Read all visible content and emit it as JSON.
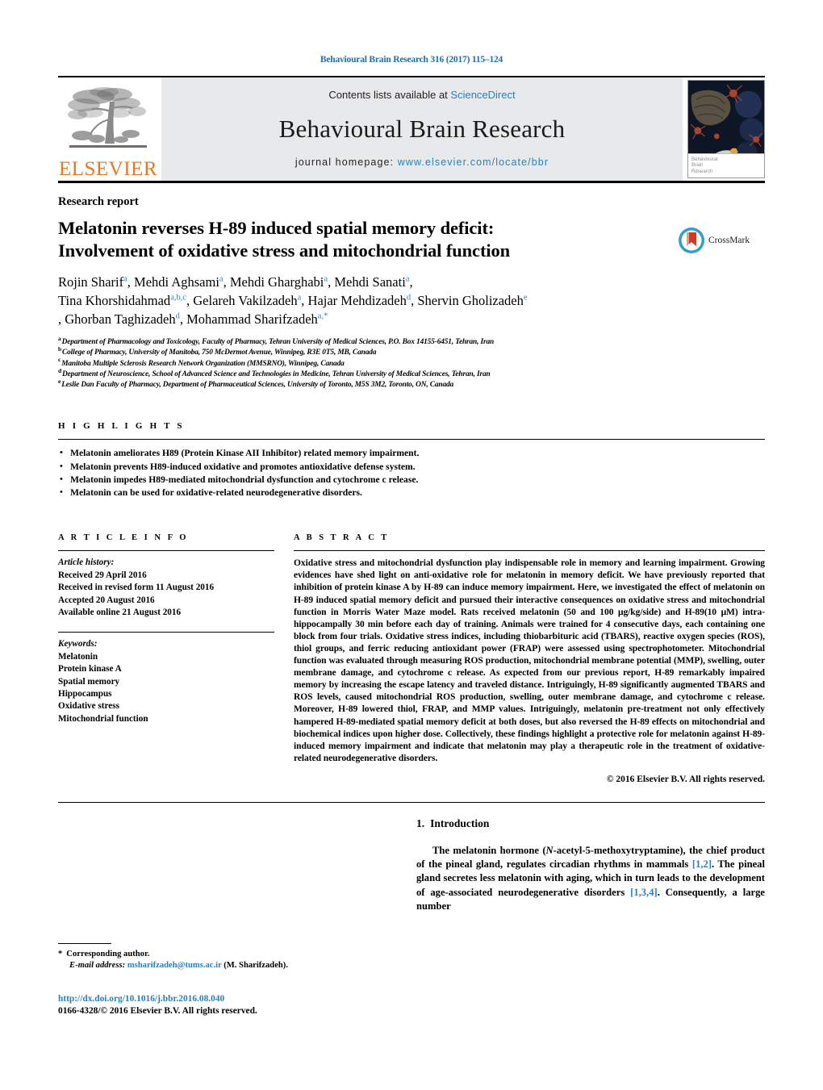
{
  "running_head": "Behavioural Brain Research 316 (2017) 115–124",
  "masthead": {
    "contents_prefix": "Contents lists available at ",
    "sciencedirect": "ScienceDirect",
    "journal_title": "Behavioural Brain Research",
    "homepage_label": "journal homepage: ",
    "homepage_url": "www.elsevier.com/locate/bbr",
    "publisher_logo_text": "ELSEVIER",
    "cover_caption": "Behavioural\nBrain\nResearch",
    "accent_blue": "#2b7fba",
    "elsevier_orange": "#E87722",
    "panel_gray": "#e8e9ea"
  },
  "article": {
    "kind": "Research report",
    "title_line1": "Melatonin reverses H-89 induced spatial memory deficit:",
    "title_line2": "Involvement of oxidative stress and mitochondrial function",
    "crossmark_label": "CrossMark",
    "authors": [
      {
        "name": "Rojin Sharif",
        "sup": "a",
        "sep": ", "
      },
      {
        "name": "Mehdi Aghsami",
        "sup": "a",
        "sep": ", "
      },
      {
        "name": "Mehdi Gharghabi",
        "sup": "a",
        "sep": ", "
      },
      {
        "name": "Mehdi Sanati",
        "sup": "a",
        "sep": ","
      },
      {
        "name": "Tina Khorshidahmad",
        "sup": "a,b,c",
        "sep": ", "
      },
      {
        "name": "Gelareh Vakilzadeh",
        "sup": "a",
        "sep": ", "
      },
      {
        "name": "Hajar Mehdizadeh",
        "sup": "d",
        "sep": ", "
      },
      {
        "name": "Shervin Gholizadeh",
        "sup": "e",
        "sep": ""
      },
      {
        "name": ", Ghorban Taghizadeh",
        "sup": "d",
        "sep": ", "
      },
      {
        "name": "Mohammad Sharifzadeh",
        "sup": "a,*",
        "sep": ""
      }
    ],
    "authors_line1": "Rojin Sharif^a, Mehdi Aghsami^a, Mehdi Gharghabi^a, Mehdi Sanati^a,",
    "authors_line2": "Tina Khorshidahmad^a,b,c, Gelareh Vakilzadeh^a, Hajar Mehdizadeh^d, Shervin Gholizadeh^e",
    "authors_line3": ", Ghorban Taghizadeh^d, Mohammad Sharifzadeh^a,*",
    "affiliations": [
      {
        "label": "a",
        "text": "Department of Pharmacology and Toxicology, Faculty of Pharmacy, Tehran University of Medical Sciences, P.O. Box 14155-6451, Tehran, Iran"
      },
      {
        "label": "b",
        "text": "College of Pharmacy, University of Manitoba, 750 McDermot Avenue, Winnipeg, R3E 0T5, MB, Canada"
      },
      {
        "label": "c",
        "text": "Manitoba Multiple Sclerosis Research Network Organization (MMSRNO), Winnipeg, Canada"
      },
      {
        "label": "d",
        "text": "Department of Neuroscience, School of Advanced Science and Technologies in Medicine, Tehran University of Medical Sciences, Tehran, Iran"
      },
      {
        "label": "e",
        "text": "Leslie Dan Faculty of Pharmacy, Department of Pharmaceutical Sciences, University of Toronto, M5S 3M2, Toronto, ON, Canada"
      }
    ]
  },
  "highlights": {
    "heading": "H I G H L I G H T S",
    "items": [
      "Melatonin ameliorates H89 (Protein Kinase AII Inhibitor) related memory impairment.",
      "Melatonin prevents H89-induced oxidative and promotes antioxidative defense system.",
      "Melatonin impedes H89-mediated mitochondrial dysfunction and cytochrome c release.",
      "Melatonin can be used for oxidative-related neurodegenerative disorders."
    ]
  },
  "article_info": {
    "heading": "A R T I C L E    I N F O",
    "history_label": "Article history:",
    "history": [
      "Received 29 April 2016",
      "Received in revised form 11 August 2016",
      "Accepted 20 August 2016",
      "Available online 21 August 2016"
    ],
    "keywords_label": "Keywords:",
    "keywords": [
      "Melatonin",
      "Protein kinase A",
      "Spatial memory",
      "Hippocampus",
      "Oxidative stress",
      "Mitochondrial function"
    ]
  },
  "abstract": {
    "heading": "A B S T R A C T",
    "body": "Oxidative stress and mitochondrial dysfunction play indispensable role in memory and learning impairment. Growing evidences have shed light on anti-oxidative role for melatonin in memory deficit. We have previously reported that inhibition of protein kinase A by H-89 can induce memory impairment. Here, we investigated the effect of melatonin on H-89 induced spatial memory deficit and pursued their interactive consequences on oxidative stress and mitochondrial function in Morris Water Maze model. Rats received melatonin (50 and 100 μg/kg/side) and H-89(10 μM) intra-hippocampally 30 min before each day of training. Animals were trained for 4 consecutive days, each containing one block from four trials. Oxidative stress indices, including thiobarbituric acid (TBARS), reactive oxygen species (ROS), thiol groups, and ferric reducing antioxidant power (FRAP) were assessed using spectrophotometer. Mitochondrial function was evaluated through measuring ROS production, mitochondrial membrane potential (MMP), swelling, outer membrane damage, and cytochrome c release. As expected from our previous report, H-89 remarkably impaired memory by increasing the escape latency and traveled distance. Intriguingly, H-89 significantly augmented TBARS and ROS levels, caused mitochondrial ROS production, swelling, outer membrane damage, and cytochrome c release. Moreover, H-89 lowered thiol, FRAP, and MMP values. Intriguingly, melatonin pre-treatment not only effectively hampered H-89-mediated spatial memory deficit at both doses, but also reversed the H-89 effects on mitochondrial and biochemical indices upon higher dose. Collectively, these findings highlight a protective role for melatonin against H-89-induced memory impairment and indicate that melatonin may play a therapeutic role in the treatment of oxidative- related neurodegenerative disorders.",
    "copyright": "© 2016 Elsevier B.V. All rights reserved."
  },
  "introduction": {
    "number": "1.",
    "heading": "Introduction",
    "paragraph_parts": {
      "p1": "The melatonin hormone (",
      "italic1": "N",
      "p2": "-acetyl-5-methoxytryptamine), the chief product of the pineal gland, regulates circadian rhythms in mammals ",
      "ref1": "[1,2]",
      "p3": ". The pineal gland secretes less melatonin with aging, which in turn leads to the development of age-associated neurodegenerative disorders ",
      "ref2": "[1,3,4]",
      "p4": ". Consequently, a large number"
    }
  },
  "footer": {
    "corresponding_star": "*",
    "corresponding_label": "Corresponding author.",
    "email_label": "E-mail address:",
    "email": "msharifzadeh@tums.ac.ir",
    "email_owner": "(M. Sharifzadeh).",
    "doi": "http://dx.doi.org/10.1016/j.bbr.2016.08.040",
    "issn": "0166-4328/© 2016 Elsevier B.V. All rights reserved."
  }
}
